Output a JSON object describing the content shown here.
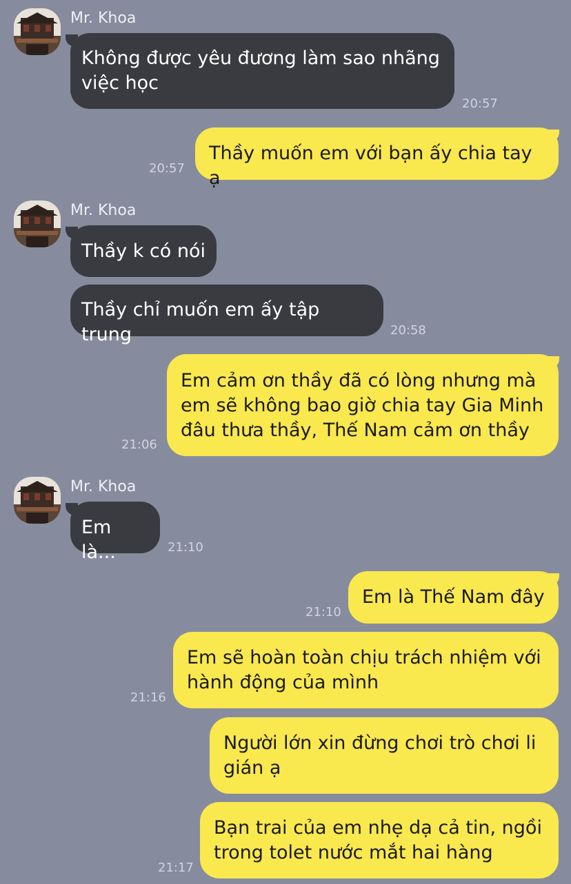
{
  "colors": {
    "background": "#868c9e",
    "incoming_bubble": "#3a3b40",
    "outgoing_bubble": "#f9e84e"
  },
  "messages": [
    {
      "sender": "Mr. Khoa",
      "text": "Không được yêu đương làm sao nhãng\nviệc học",
      "time": "20:57",
      "direction": "in"
    },
    {
      "text": "Thầy muốn em với bạn ấy chia tay ạ",
      "time": "20:57",
      "direction": "out"
    },
    {
      "sender": "Mr. Khoa",
      "text": "Thầy k có nói",
      "direction": "in"
    },
    {
      "text": "Thầy chỉ muốn em ấy tập trung",
      "time": "20:58",
      "direction": "in"
    },
    {
      "text": "Em cảm ơn thầy đã có lòng nhưng mà\nem sẽ không bao giờ chia tay Gia Minh\nđâu thưa thầy, Thế Nam cảm ơn thầy",
      "time": "21:06",
      "direction": "out"
    },
    {
      "sender": "Mr. Khoa",
      "text": "Em là...",
      "time": "21:10",
      "direction": "in"
    },
    {
      "text": "Em là Thế Nam đây",
      "time": "21:10",
      "direction": "out"
    },
    {
      "text": "Em sẽ hoàn toàn chịu trách nhiệm với\nhành động của mình",
      "time": "21:16",
      "direction": "out"
    },
    {
      "text": "Người lớn xin đừng chơi trò chơi li\ngián ạ",
      "direction": "out"
    },
    {
      "text": "Bạn trai của em nhẹ dạ cả tin, ngồi\ntrong tolet nước mắt hai hàng",
      "time": "21:17",
      "direction": "out"
    }
  ]
}
